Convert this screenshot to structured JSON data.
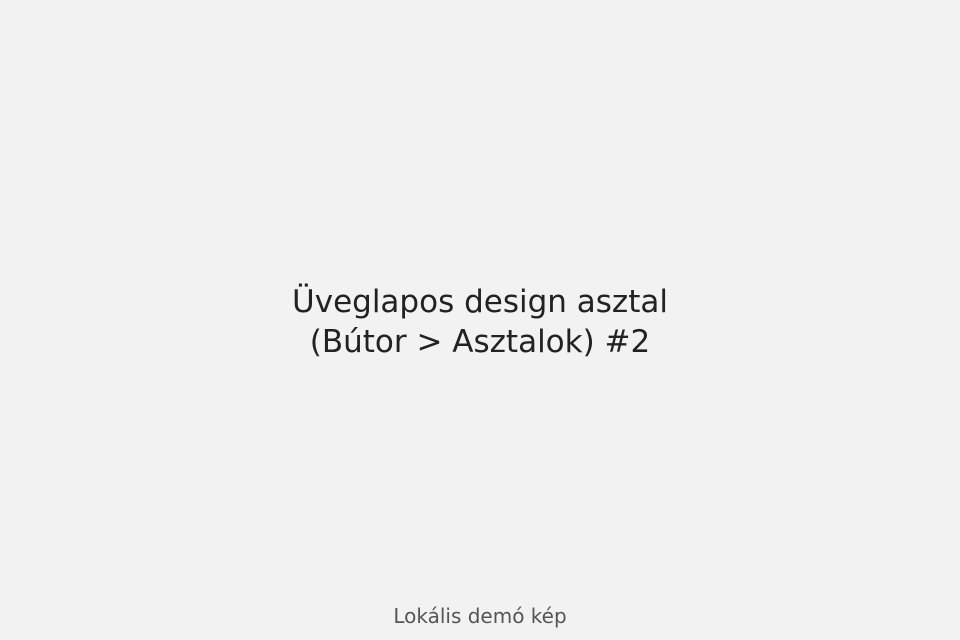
{
  "image": {
    "title_line_1": "Üveglapos design asztal",
    "title_line_2": "(Bútor > Asztalok) #2",
    "caption": "Lokális demó kép"
  },
  "colors": {
    "background": "#f2f2f2",
    "title_text": "#222222",
    "caption_text": "#555555"
  }
}
